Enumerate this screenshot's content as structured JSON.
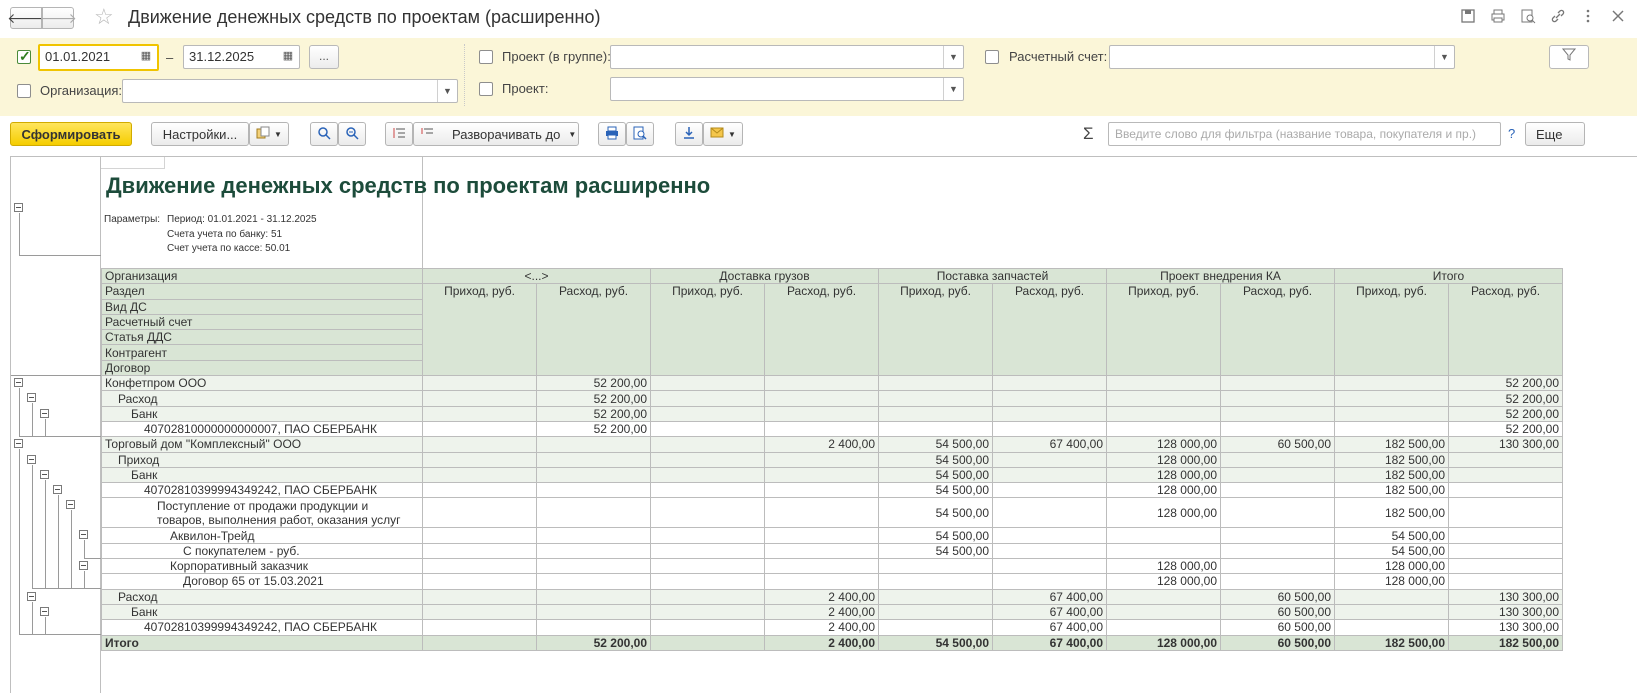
{
  "window": {
    "title": "Движение денежных средств по проектам (расширенно)",
    "back_icon": "🡐",
    "forward_icon": "🡒",
    "favorite_icon": "☆",
    "icons": [
      "save-icon",
      "print-icon",
      "preview-icon",
      "link-icon",
      "more-icon",
      "close-icon"
    ]
  },
  "filters": {
    "period_enabled": true,
    "date_from": "01.01.2021",
    "date_to": "31.12.2025",
    "dash": "–",
    "dots_label": "...",
    "organization_label": "Организация:",
    "organization_value": "",
    "project_group_label": "Проект (в группе):",
    "project_group_value": "",
    "project_label": "Проект:",
    "project_value": "",
    "account_label": "Расчетный счет:",
    "account_value": ""
  },
  "toolbar": {
    "generate_label": "Сформировать",
    "settings_label": "Настройки...",
    "expand_label": "Разворачивать до",
    "sigma": "Σ",
    "search_placeholder": "Введите слово для фильтра (название товара, покупателя и пр.)",
    "help": "?",
    "more_label": "Еще"
  },
  "report": {
    "title": "Движение денежных средств по проектам расширенно",
    "params_label": "Параметры:",
    "params": [
      "Период: 01.01.2021 - 31.12.2025",
      "Счета учета по банку: 51",
      "Счет учета по кассе: 50.01"
    ],
    "row_dimensions": [
      "Организация",
      "Раздел",
      "Вид ДС",
      "Расчетный счет",
      "Статья ДДС",
      "Контрагент",
      "Договор"
    ],
    "projects": [
      "<...>",
      "Доставка грузов",
      "Поставка запчастей",
      "Проект внедрения КА",
      "Итого"
    ],
    "income_label": "Приход, руб.",
    "expense_label": "Расход, руб.",
    "rows": [
      {
        "label": "Конфетпром ООО",
        "indent": 0,
        "style": "green",
        "values": [
          "",
          "52 200,00",
          "",
          "",
          "",
          "",
          "",
          "",
          "",
          "52 200,00"
        ]
      },
      {
        "label": "Расход",
        "indent": 1,
        "style": "green",
        "values": [
          "",
          "52 200,00",
          "",
          "",
          "",
          "",
          "",
          "",
          "",
          "52 200,00"
        ]
      },
      {
        "label": "Банк",
        "indent": 2,
        "style": "green",
        "values": [
          "",
          "52 200,00",
          "",
          "",
          "",
          "",
          "",
          "",
          "",
          "52 200,00"
        ]
      },
      {
        "label": "40702810000000000007, ПАО СБЕРБАНК",
        "indent": 3,
        "style": "white",
        "values": [
          "",
          "52 200,00",
          "",
          "",
          "",
          "",
          "",
          "",
          "",
          "52 200,00"
        ]
      },
      {
        "label": "Торговый дом \"Комплексный\" ООО",
        "indent": 0,
        "style": "green",
        "values": [
          "",
          "",
          "",
          "2 400,00",
          "54 500,00",
          "67 400,00",
          "128 000,00",
          "60 500,00",
          "182 500,00",
          "130 300,00"
        ]
      },
      {
        "label": "Приход",
        "indent": 1,
        "style": "green",
        "values": [
          "",
          "",
          "",
          "",
          "54 500,00",
          "",
          "128 000,00",
          "",
          "182 500,00",
          ""
        ]
      },
      {
        "label": "Банк",
        "indent": 2,
        "style": "green",
        "values": [
          "",
          "",
          "",
          "",
          "54 500,00",
          "",
          "128 000,00",
          "",
          "182 500,00",
          ""
        ]
      },
      {
        "label": "40702810399994349242, ПАО СБЕРБАНК",
        "indent": 3,
        "style": "white",
        "values": [
          "",
          "",
          "",
          "",
          "54 500,00",
          "",
          "128 000,00",
          "",
          "182 500,00",
          ""
        ]
      },
      {
        "label": "Поступление от продажи продукции и товаров, выполнения работ, оказания услуг",
        "indent": 4,
        "style": "white",
        "multi": true,
        "values": [
          "",
          "",
          "",
          "",
          "54 500,00",
          "",
          "128 000,00",
          "",
          "182 500,00",
          ""
        ]
      },
      {
        "label": "Аквилон-Трейд",
        "indent": 5,
        "style": "white",
        "values": [
          "",
          "",
          "",
          "",
          "54 500,00",
          "",
          "",
          "",
          "54 500,00",
          ""
        ]
      },
      {
        "label": "С покупателем - руб.",
        "indent": 6,
        "style": "white",
        "values": [
          "",
          "",
          "",
          "",
          "54 500,00",
          "",
          "",
          "",
          "54 500,00",
          ""
        ]
      },
      {
        "label": "Корпоративный заказчик",
        "indent": 5,
        "style": "white",
        "values": [
          "",
          "",
          "",
          "",
          "",
          "",
          "128 000,00",
          "",
          "128 000,00",
          ""
        ]
      },
      {
        "label": "Договор 65 от 15.03.2021",
        "indent": 6,
        "style": "white",
        "values": [
          "",
          "",
          "",
          "",
          "",
          "",
          "128 000,00",
          "",
          "128 000,00",
          ""
        ]
      },
      {
        "label": "Расход",
        "indent": 1,
        "style": "green",
        "values": [
          "",
          "",
          "",
          "2 400,00",
          "",
          "67 400,00",
          "",
          "60 500,00",
          "",
          "130 300,00"
        ]
      },
      {
        "label": "Банк",
        "indent": 2,
        "style": "green",
        "values": [
          "",
          "",
          "",
          "2 400,00",
          "",
          "67 400,00",
          "",
          "60 500,00",
          "",
          "130 300,00"
        ]
      },
      {
        "label": "40702810399994349242, ПАО СБЕРБАНК",
        "indent": 3,
        "style": "white",
        "values": [
          "",
          "",
          "",
          "2 400,00",
          "",
          "67 400,00",
          "",
          "60 500,00",
          "",
          "130 300,00"
        ]
      }
    ],
    "total": {
      "label": "Итого",
      "values": [
        "",
        "52 200,00",
        "",
        "2 400,00",
        "54 500,00",
        "67 400,00",
        "128 000,00",
        "60 500,00",
        "182 500,00",
        "182 500,00"
      ]
    }
  }
}
